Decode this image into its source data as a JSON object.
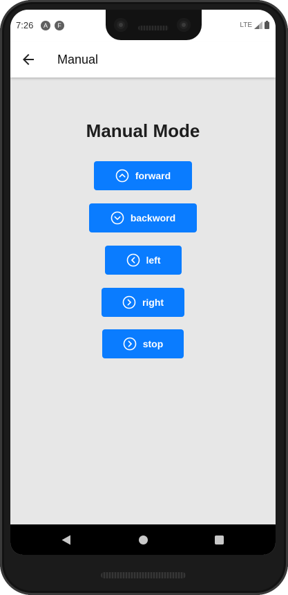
{
  "status_bar": {
    "time": "7:26",
    "app_icon_1": "A",
    "app_icon_2": "F",
    "network": "LTE"
  },
  "app_bar": {
    "back_icon": "arrow-back-icon",
    "title": "Manual"
  },
  "main": {
    "heading": "Manual Mode",
    "buttons": [
      {
        "label": "forward",
        "icon": "chevron-up-circle-icon"
      },
      {
        "label": "backword",
        "icon": "chevron-down-circle-icon"
      },
      {
        "label": "left",
        "icon": "chevron-left-circle-icon"
      },
      {
        "label": "right",
        "icon": "chevron-right-circle-icon"
      },
      {
        "label": "stop",
        "icon": "chevron-right-circle-icon"
      }
    ]
  },
  "nav_bar": {
    "back": "triangle-back-icon",
    "home": "circle-home-icon",
    "recents": "square-recents-icon"
  },
  "colors": {
    "accent": "#0a7cff",
    "background": "#e7e7e7",
    "appbar": "#ffffff"
  }
}
